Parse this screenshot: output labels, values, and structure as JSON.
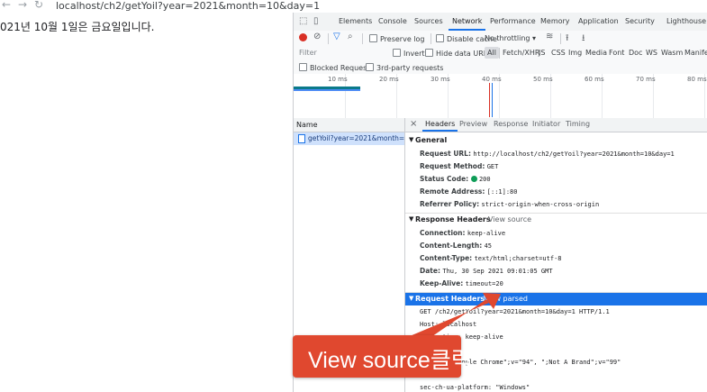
{
  "browser": {
    "back_glyph": "←",
    "forward_glyph": "→",
    "reload_glyph": "↻",
    "url": "localhost/ch2/getYoil?year=2021&month=10&day=1"
  },
  "page": {
    "body_text": "021년 10월 1일은 금요일입니다."
  },
  "devtools": {
    "tabs": [
      "Elements",
      "Console",
      "Sources",
      "Network",
      "Performance",
      "Memory",
      "Application",
      "Security",
      "Lighthouse"
    ],
    "active_tab": "Network",
    "toolbar": {
      "preserve_log": "Preserve log",
      "disable_cache": "Disable cache",
      "throttling": "No throttling"
    },
    "filter_bar": {
      "filter_placeholder": "Filter",
      "invert": "Invert",
      "hide_data_urls": "Hide data URLs",
      "types": [
        "All",
        "Fetch/XHR",
        "JS",
        "CSS",
        "Img",
        "Media",
        "Font",
        "Doc",
        "WS",
        "Wasm",
        "Manifest"
      ]
    },
    "blocked_requests": "Blocked Requests",
    "third_party": "3rd-party requests",
    "timeline_ticks": [
      "10 ms",
      "20 ms",
      "30 ms",
      "40 ms",
      "50 ms",
      "60 ms",
      "70 ms",
      "80 ms"
    ],
    "requests": {
      "column_name": "Name",
      "items": [
        "getYoil?year=2021&month=1..."
      ]
    },
    "detail": {
      "close_glyph": "×",
      "tabs": [
        "Headers",
        "Preview",
        "Response",
        "Initiator",
        "Timing"
      ],
      "general": {
        "title": "General",
        "rows": [
          {
            "k": "Request URL:",
            "v": "http://localhost/ch2/getYoil?year=2021&month=10&day=1"
          },
          {
            "k": "Request Method:",
            "v": "GET"
          },
          {
            "k": "Status Code:",
            "v": "200"
          },
          {
            "k": "Remote Address:",
            "v": "[::1]:80"
          },
          {
            "k": "Referrer Policy:",
            "v": "strict-origin-when-cross-origin"
          }
        ]
      },
      "response_headers": {
        "title": "Response Headers",
        "toggle": "View source",
        "rows": [
          {
            "k": "Connection:",
            "v": "keep-alive"
          },
          {
            "k": "Content-Length:",
            "v": "45"
          },
          {
            "k": "Content-Type:",
            "v": "text/html;charset=utf-8"
          },
          {
            "k": "Date:",
            "v": "Thu, 30 Sep 2021 09:01:05 GMT"
          },
          {
            "k": "Keep-Alive:",
            "v": "timeout=20"
          }
        ]
      },
      "request_headers": {
        "title": "Request Headers",
        "toggle": "View parsed",
        "raw_lines": [
          "GET /ch2/getYoil?year=2021&month=10&day=1 HTTP/1.1",
          "Host: localhost",
          "Connection: keep-alive",
          "                    0",
          "         v=\"94\", \"Google Chrome\";v=\"94\", \";Not A Brand\";v=\"99\"",
          "",
          "sec-ch-ua-platform: \"Windows\""
        ]
      }
    }
  },
  "annotation": {
    "text": "View source클릭"
  },
  "colors": {
    "accent": "#1a73e8",
    "record_red": "#d93025",
    "status_green": "#0f9d58",
    "callout": "#e0482f"
  }
}
